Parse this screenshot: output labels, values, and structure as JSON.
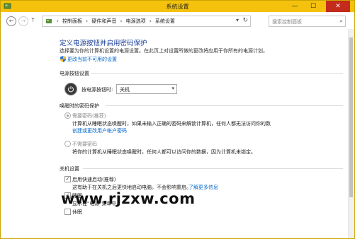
{
  "window": {
    "title": "系统设置",
    "controls": {
      "minimize": "—",
      "maximize": "☐",
      "close": "✕"
    }
  },
  "nav": {
    "back": "←",
    "forward": "→",
    "up": "↑",
    "breadcrumbs": [
      "控制面板",
      "硬件和声音",
      "电源选项",
      "系统设置"
    ],
    "separator": "›",
    "search_placeholder": "搜索控制面板"
  },
  "page": {
    "title": "定义电源按钮并启用密码保护",
    "subtitle": "选择要为你的计算机设置的电源设置。在此页上对设置所做的更改将应用于你所有的电源计划。",
    "change_link": "更改当前不可用的设置"
  },
  "power_button": {
    "heading": "电源按钮设置",
    "label": "按电源按钮时:",
    "selected": "关机"
  },
  "wake_password": {
    "heading": "唤醒时的密码保护",
    "option1_label": "需要密码(推荐)",
    "option1_desc": "计算机从睡眠状态唤醒时，如果未输入正确的密码来解锁计算机，任何人都无法访问你的数",
    "option1_desc2": "据。",
    "option1_link": "创建或更改用户帐户密码",
    "option2_label": "不需要密码",
    "option2_desc": "将你的计算机从睡眠状态唤醒时，任何人都可以访问你的数据，因为计算机未锁定。"
  },
  "shutdown": {
    "heading": "关机设置",
    "fast_startup_label": "启用快速启动(推荐)",
    "fast_startup_desc": "这有助于在关机之后更快地启动电脑。不会影响重启。",
    "learn_more": "了解更多信息",
    "sleep_label": "睡眠",
    "sleep_desc": "显示在\"电源\"菜单中。",
    "hibernate_label": "休眠"
  },
  "watermark": "www.rjzxw.com",
  "colors": {
    "titlebar": "#f4c20d",
    "link": "#0066cc",
    "heading": "#1a3e9a"
  }
}
